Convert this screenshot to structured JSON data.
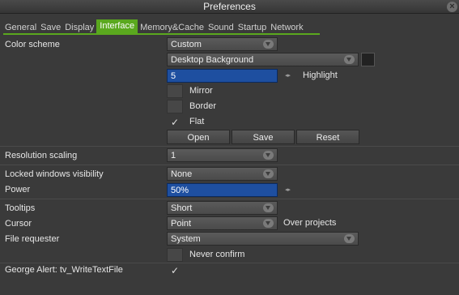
{
  "window": {
    "title": "Preferences",
    "close_icon": "close-icon"
  },
  "tabs": [
    {
      "label": "General"
    },
    {
      "label": "Save"
    },
    {
      "label": "Display"
    },
    {
      "label": "Interface",
      "active": true
    },
    {
      "label": "Memory&Cache"
    },
    {
      "label": "Sound"
    },
    {
      "label": "Startup"
    },
    {
      "label": "Network"
    }
  ],
  "color_scheme": {
    "label": "Color scheme",
    "scheme_value": "Custom",
    "background_value": "Desktop Background",
    "highlight_value": "5",
    "highlight_label": "Highlight",
    "mirror_label": "Mirror",
    "border_label": "Border",
    "flat_label": "Flat",
    "open_label": "Open",
    "save_label": "Save",
    "reset_label": "Reset"
  },
  "resolution": {
    "label": "Resolution scaling",
    "value": "1"
  },
  "locked_windows": {
    "label": "Locked windows visibility",
    "value": "None"
  },
  "power": {
    "label": "Power",
    "value": "50%"
  },
  "tooltips": {
    "label": "Tooltips",
    "value": "Short"
  },
  "cursor": {
    "label": "Cursor",
    "value": "Point",
    "after_label": "Over projects"
  },
  "file_requester": {
    "label": "File requester",
    "value": "System",
    "never_confirm_label": "Never confirm"
  },
  "george_alert": {
    "label": "George Alert: tv_WriteTextFile"
  },
  "colors": {
    "accent": "#5aa81e",
    "field_blue": "#1e4fa0",
    "background": "#3a3a3a"
  }
}
